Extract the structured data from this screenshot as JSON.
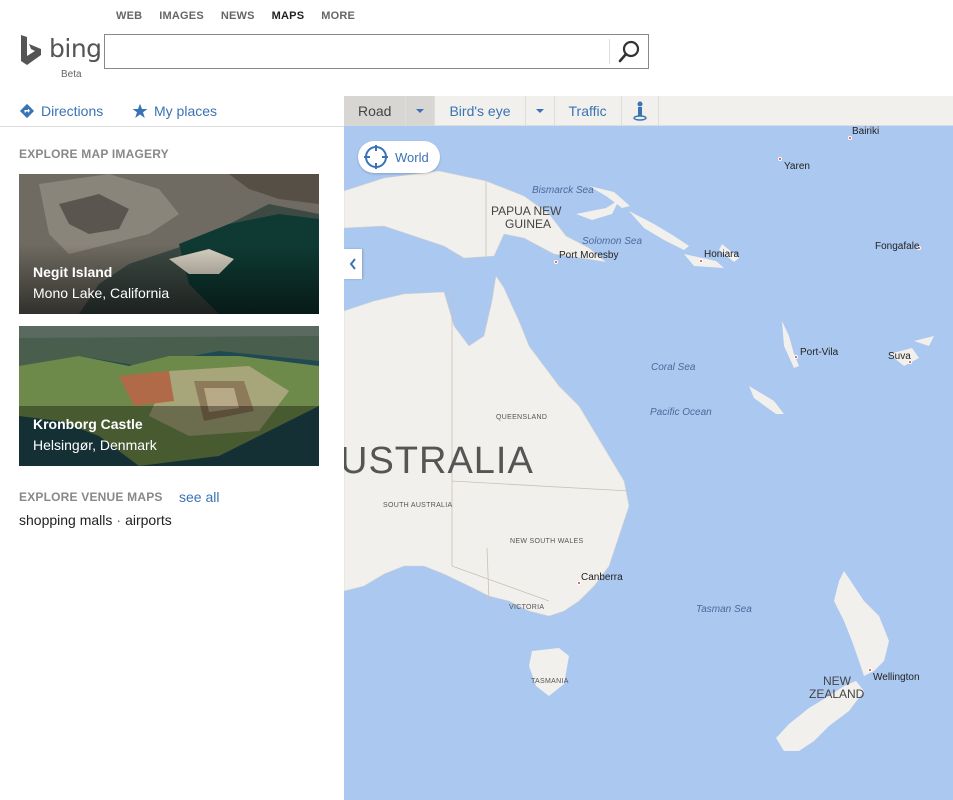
{
  "nav": {
    "web": "WEB",
    "images": "IMAGES",
    "news": "NEWS",
    "maps": "MAPS",
    "more": "MORE"
  },
  "logo": {
    "text": "bing",
    "beta": "Beta"
  },
  "search": {
    "value": "",
    "placeholder": ""
  },
  "panel": {
    "directions": "Directions",
    "my_places": "My places",
    "imagery_title": "EXPLORE MAP IMAGERY",
    "cards": [
      {
        "title": "Negit Island",
        "subtitle": "Mono Lake, California"
      },
      {
        "title": "Kronborg Castle",
        "subtitle": "Helsingør, Denmark"
      }
    ],
    "venue_title": "EXPLORE VENUE MAPS",
    "see_all": "see all",
    "venues": [
      "shopping malls",
      "airports"
    ],
    "venue_separator": "·"
  },
  "map_toolbar": {
    "road": "Road",
    "birds_eye": "Bird's eye",
    "traffic": "Traffic"
  },
  "map": {
    "world_button": "World",
    "labels": {
      "australia": "USTRALIA",
      "papua": "PAPUA NEW",
      "guinea": "GUINEA",
      "nz1": "NEW",
      "nz2": "ZEALAND",
      "queensland": "QUEENSLAND",
      "south_australia": "SOUTH AUSTRALIA",
      "nsw": "NEW SOUTH WALES",
      "victoria": "VICTORIA",
      "tasmania": "TASMANIA",
      "bismarck": "Bismarck Sea",
      "solomon": "Solomon Sea",
      "coral": "Coral Sea",
      "pacific": "Pacific Ocean",
      "tasman": "Tasman Sea",
      "bairiki": "Bairiki",
      "yaren": "Yaren",
      "port_moresby": "Port Moresby",
      "honiara": "Honiara",
      "fongafale": "Fongafale",
      "port_vila": "Port-Vila",
      "suva": "Suva",
      "canberra": "Canberra",
      "wellington": "Wellington"
    }
  },
  "colors": {
    "link": "#3a73b5",
    "water": "#abc8f0",
    "land": "#f2f0ec"
  }
}
